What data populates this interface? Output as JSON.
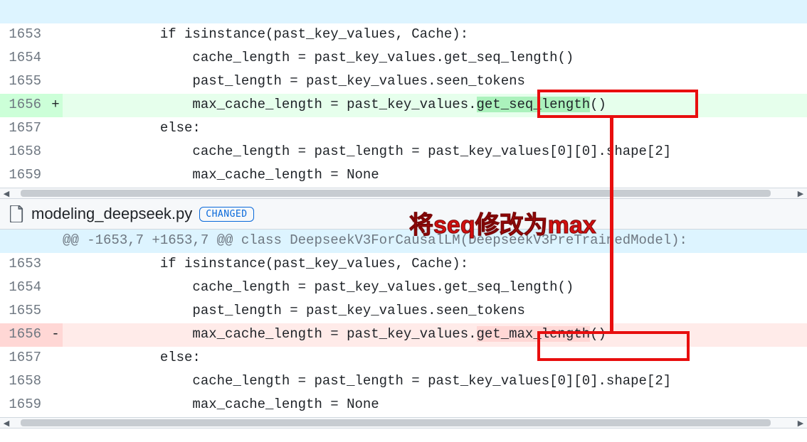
{
  "top_panel": {
    "rows": [
      {
        "type": "blank-hunk",
        "line": "",
        "marker": "",
        "code": " "
      },
      {
        "type": "ctx",
        "line": "1653",
        "marker": "",
        "code": "            if isinstance(past_key_values, Cache):"
      },
      {
        "type": "ctx",
        "line": "1654",
        "marker": "",
        "code": "                cache_length = past_key_values.get_seq_length()"
      },
      {
        "type": "ctx",
        "line": "1655",
        "marker": "",
        "code": "                past_length = past_key_values.seen_tokens"
      },
      {
        "type": "add",
        "line": "1656",
        "marker": "+",
        "code_pre": "                max_cache_length = past_key_values.",
        "code_hl": "get_seq_length",
        "code_post": "()"
      },
      {
        "type": "ctx",
        "line": "1657",
        "marker": "",
        "code": "            else:"
      },
      {
        "type": "ctx",
        "line": "1658",
        "marker": "",
        "code": "                cache_length = past_length = past_key_values[0][0].shape[2]"
      },
      {
        "type": "ctx",
        "line": "1659",
        "marker": "",
        "code": "                max_cache_length = None"
      }
    ]
  },
  "file_header": {
    "filename": "modeling_deepseek.py",
    "badge": "CHANGED"
  },
  "bottom_panel": {
    "hunk": "@@ -1653,7 +1653,7 @@ class DeepseekV3ForCausalLM(DeepseekV3PreTrainedModel):",
    "rows": [
      {
        "type": "ctx",
        "line": "1653",
        "marker": "",
        "code": "            if isinstance(past_key_values, Cache):"
      },
      {
        "type": "ctx",
        "line": "1654",
        "marker": "",
        "code": "                cache_length = past_key_values.get_seq_length()"
      },
      {
        "type": "ctx",
        "line": "1655",
        "marker": "",
        "code": "                past_length = past_key_values.seen_tokens"
      },
      {
        "type": "del",
        "line": "1656",
        "marker": "-",
        "code_pre": "                max_cache_length = past_key_values.",
        "code_hl": "get_max_length",
        "code_post": "()"
      },
      {
        "type": "ctx",
        "line": "1657",
        "marker": "",
        "code": "            else:"
      },
      {
        "type": "ctx",
        "line": "1658",
        "marker": "",
        "code": "                cache_length = past_length = past_key_values[0][0].shape[2]"
      },
      {
        "type": "ctx",
        "line": "1659",
        "marker": "",
        "code": "                max_cache_length = None"
      }
    ]
  },
  "annotation": {
    "text": "将seq修改为max"
  },
  "scroll": {
    "top_thumb_left_pct": 1,
    "top_thumb_width_pct": 96,
    "bottom_thumb_left_pct": 1,
    "bottom_thumb_width_pct": 96
  }
}
